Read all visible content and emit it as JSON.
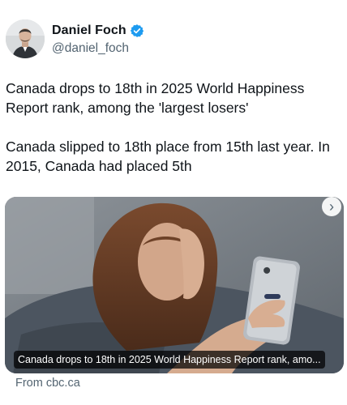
{
  "author": {
    "display_name": "Daniel Foch",
    "handle": "@daniel_foch",
    "verified": true,
    "verified_color": "#1d9bf0"
  },
  "tweet": {
    "paragraphs": [
      "Canada drops to 18th in 2025 World Happiness Report rank, among the 'largest losers'",
      "Canada slipped to 18th place from 15th last year. In 2015, Canada had placed 5th"
    ]
  },
  "card": {
    "caption": "Canada drops to 18th in 2025 World Happiness Report rank, amo...",
    "source": "From cbc.ca",
    "next_glyph": "›"
  },
  "icons": {
    "verified": "verified-badge-icon",
    "next": "chevron-right-icon"
  }
}
